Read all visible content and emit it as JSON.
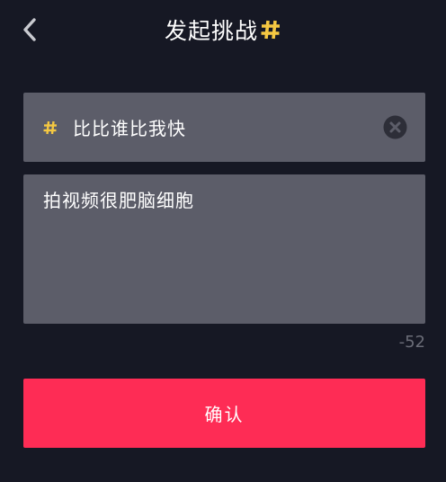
{
  "header": {
    "title": "发起挑战",
    "back_icon": "chevron-left-icon",
    "title_icon": "hashtag-icon"
  },
  "tag_input": {
    "value": "比比谁比我快",
    "prefix_icon": "hashtag-icon",
    "clear_icon": "clear-circle-icon"
  },
  "description_input": {
    "value": "拍视频很肥脑细胞"
  },
  "char_counter": "-52",
  "confirm_button": {
    "label": "确认"
  },
  "colors": {
    "background": "#161824",
    "field": "#5c5d69",
    "accent": "#fe2c55",
    "hashtag": "#f5c842"
  }
}
